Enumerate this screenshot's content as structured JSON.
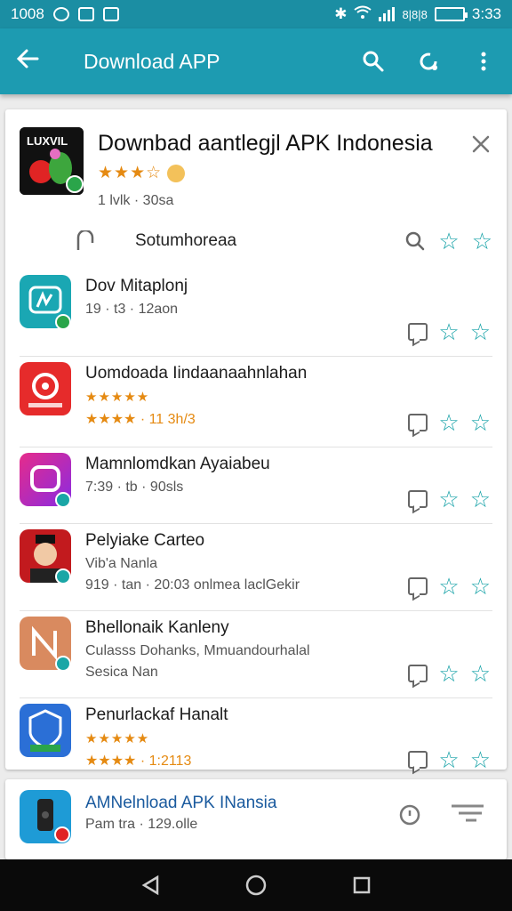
{
  "status": {
    "left_text": "1008",
    "time": "3:33",
    "carrier": "8|8|8"
  },
  "appbar": {
    "title": "Download APP"
  },
  "header_app": {
    "title": "Downbad aantlegjl APK Indonesia",
    "rating_stars": "★★★☆",
    "meta": "1 lvlk · 30sa"
  },
  "search_row": {
    "label": "Sotumhoreaa"
  },
  "apps": [
    {
      "name": "Dov Mitaplonj",
      "line2": "19 · t3 · 12aon",
      "line3": "",
      "icon_color": "#1aa7b3"
    },
    {
      "name": "Uomdoada Iindaanaahnlahan",
      "line2": "★★★★★",
      "line3": "★★★★ · 11 3h/3",
      "icon_color": "#e62b2b"
    },
    {
      "name": "Mamnlomdkan Ayaiabeu",
      "line2": "7:39 · tb · 90sls",
      "line3": "",
      "icon_color": "#d62d8c"
    },
    {
      "name": "Pelyiake Carteo",
      "line2": "Vib'a Nanla",
      "line3": "919 · tan · 20:03 onlmea laclGekir",
      "icon_color": "#b3181b"
    },
    {
      "name": "Bhellonaik Kanleny",
      "line2": "Culasss Dohanks, Mmuandourhalal",
      "line3": "Sesica Nan",
      "icon_color": "#d98a5f"
    },
    {
      "name": "Penurlackaf Hanalt",
      "line2": "★★★★★",
      "line3": "★★★★ · 1:2113",
      "icon_color": "#2b6fd6"
    }
  ],
  "bottom_app": {
    "name": "AMNelnload APK INansia",
    "meta": "Pam tra · 129.olle"
  },
  "colors": {
    "appbar": "#1d9bb1",
    "statusbar": "#1b8ea3",
    "accent_star": "#19a3a8",
    "rating": "#e58a12"
  },
  "icons": {
    "back": "arrow-left-icon",
    "search": "search-icon",
    "refresh": "refresh-icon",
    "menu": "overflow-menu-icon",
    "close": "close-icon",
    "star": "star-icon",
    "comment": "comment-icon"
  }
}
